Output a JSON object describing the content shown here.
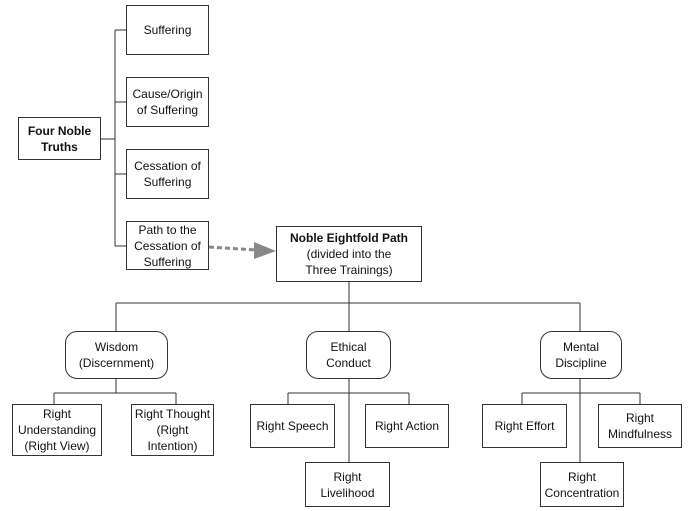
{
  "four_noble_truths": {
    "root": "Four Noble\nTruths",
    "truths": [
      "Suffering",
      "Cause/Origin\nof Suffering",
      "Cessation of\nSuffering",
      "Path to the\nCessation of\nSuffering"
    ]
  },
  "eightfold": {
    "title": "Noble Eightfold Path",
    "subtitle": "(divided into the\nThree Trainings)"
  },
  "trainings": [
    {
      "label": "Wisdom\n(Discernment)",
      "children": [
        "Right\nUnderstanding\n(Right View)",
        "Right Thought\n(Right\nIntention)"
      ]
    },
    {
      "label": "Ethical\nConduct",
      "children": [
        "Right Speech",
        "Right Action",
        "Right\nLivelihood"
      ]
    },
    {
      "label": "Mental\nDiscipline",
      "children": [
        "Right Effort",
        "Right\nMindfulness",
        "Right\nConcentration"
      ]
    }
  ],
  "colors": {
    "line": "#333333",
    "arrow": "#888888"
  }
}
